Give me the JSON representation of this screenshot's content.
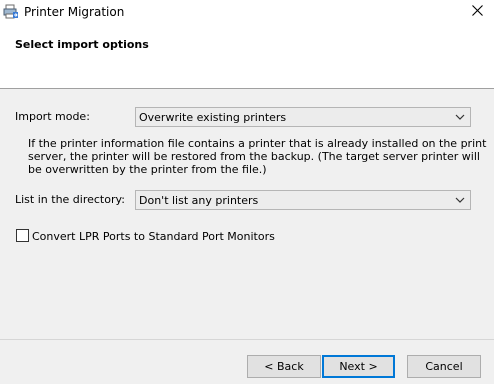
{
  "window": {
    "title": "Printer Migration",
    "icon": "printer-migration-icon",
    "close_icon": "close-icon"
  },
  "header": {
    "title": "Select import options"
  },
  "import_mode": {
    "label": "Import mode:",
    "selected": "Overwrite existing printers",
    "description": "If the printer information file contains a printer that is already installed on the print server, the printer will be restored from the backup.  (The target server printer will be overwritten by the printer from the file.)"
  },
  "directory": {
    "label": "List in the directory:",
    "selected": "Don't list any printers"
  },
  "lpr_option": {
    "label": "Convert LPR Ports to Standard Port Monitors",
    "checked": false
  },
  "buttons": {
    "back": "< Back",
    "next": "Next >",
    "cancel": "Cancel"
  },
  "colors": {
    "accent": "#0078d7",
    "panel": "#f0f0f0",
    "combo_bg": "#ececec"
  }
}
